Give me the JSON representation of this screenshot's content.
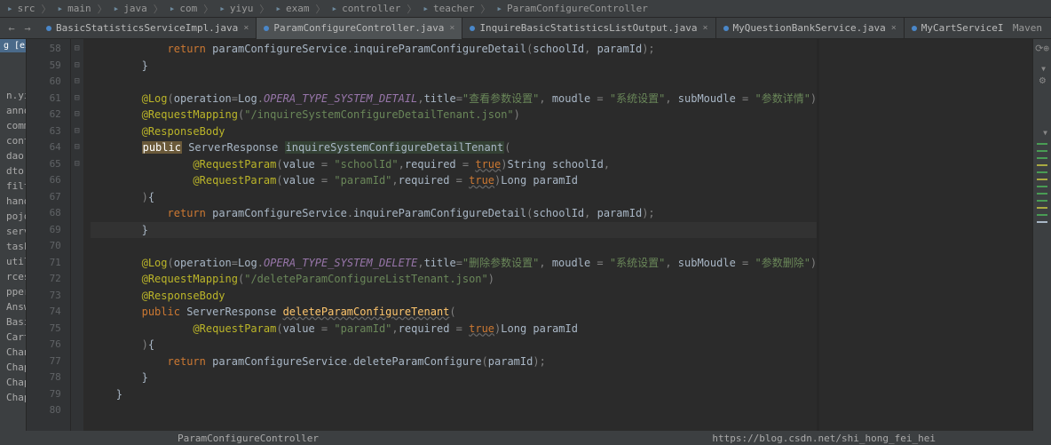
{
  "breadcrumb": [
    "src",
    "main",
    "java",
    "com",
    "yiyu",
    "exam",
    "controller",
    "teacher",
    "ParamConfigureController"
  ],
  "sidebar_header": "g [exam]  D:\\yiyu\\exam\\br...",
  "tabs": [
    {
      "label": "BasicStatisticsServiceImpl.java",
      "active": false
    },
    {
      "label": "ParamConfigureController.java",
      "active": true
    },
    {
      "label": "InquireBasicStatisticsListOutput.java",
      "active": false
    },
    {
      "label": "MyQuestionBankService.java",
      "active": false
    },
    {
      "label": "MyCartServiceImpl.java",
      "active": false
    }
  ],
  "maven_label": "Maven",
  "sidebar_items": [
    "n.yiyu.exam",
    "annotation",
    "common",
    "controller",
    "dao",
    "dto",
    "filter",
    "handle",
    "pojo",
    "service",
    "task",
    "util",
    "rces",
    "ppers",
    "AnswerQuestionMapper.xn",
    "BasicStatisticsMapper.xi",
    "CartMapper.xml",
    "ChannelTypeMapper.xml",
    "ChapterAnswerQuestionMa",
    "ChapterPaperChannelType",
    "ChapterPaperMapper.xml"
  ],
  "line_start": 58,
  "line_end": 80,
  "code_lines": {
    "58": {
      "indent": 3,
      "raw": "return paramConfigureService.inquireParamConfigureDetail(schoolId, paramId);",
      "tk": [
        [
          "k-orange",
          "return "
        ],
        [
          "k-white",
          "paramConfigureService"
        ],
        [
          "k-grey",
          "."
        ],
        [
          "k-white",
          "inquireParamConfigureDetail"
        ],
        [
          "k-grey",
          "("
        ],
        [
          "k-white",
          "schoolId"
        ],
        [
          "k-grey",
          ", "
        ],
        [
          "k-white",
          "paramId"
        ],
        [
          "k-grey",
          ")"
        ],
        [
          "k-grey",
          ";"
        ]
      ]
    },
    "59": {
      "indent": 2,
      "tk": [
        [
          "k-white",
          "}"
        ]
      ]
    },
    "60": {
      "indent": 0,
      "tk": []
    },
    "61": {
      "indent": 2,
      "tk": [
        [
          "k-anno",
          "@Log"
        ],
        [
          "k-grey",
          "("
        ],
        [
          "k-white",
          "operation"
        ],
        [
          "k-grey",
          "="
        ],
        [
          "k-white",
          "Log"
        ],
        [
          "k-grey",
          "."
        ],
        [
          "k-purple",
          "OPERA_TYPE_SYSTEM_DETAIL"
        ],
        [
          "k-grey",
          ","
        ],
        [
          "k-white",
          "title"
        ],
        [
          "k-grey",
          "="
        ],
        [
          "k-str",
          "\"查看参数设置\""
        ],
        [
          "k-grey",
          ", "
        ],
        [
          "k-white",
          "moudle "
        ],
        [
          "k-grey",
          "= "
        ],
        [
          "k-str",
          "\"系统设置\""
        ],
        [
          "k-grey",
          ", "
        ],
        [
          "k-white",
          "subMoudle "
        ],
        [
          "k-grey",
          "= "
        ],
        [
          "k-str",
          "\"参数详情\""
        ],
        [
          "k-grey",
          ")"
        ]
      ]
    },
    "62": {
      "indent": 2,
      "tk": [
        [
          "k-anno",
          "@RequestMapping"
        ],
        [
          "k-grey",
          "("
        ],
        [
          "k-str",
          "\"/inquireSystemConfigureDetailTenant.json\""
        ],
        [
          "k-grey",
          ")"
        ]
      ]
    },
    "63": {
      "indent": 2,
      "tk": [
        [
          "k-anno",
          "@ResponseBody"
        ]
      ]
    },
    "64": {
      "indent": 2,
      "tk": [
        [
          "hl-bg",
          "public"
        ],
        [
          "k-white",
          " ServerResponse "
        ],
        [
          "hl-method",
          "inquireSystemConfigureDetailTenant"
        ],
        [
          "k-grey",
          "("
        ]
      ]
    },
    "65": {
      "indent": 4,
      "tk": [
        [
          "k-anno",
          "@RequestParam"
        ],
        [
          "k-grey",
          "("
        ],
        [
          "k-white",
          "value "
        ],
        [
          "k-grey",
          "= "
        ],
        [
          "k-str",
          "\"schoolId\""
        ],
        [
          "k-grey",
          ","
        ],
        [
          "k-white",
          "required "
        ],
        [
          "k-grey",
          "= "
        ],
        [
          "k-orange underline",
          "true"
        ],
        [
          "k-grey",
          ")"
        ],
        [
          "k-white",
          "String schoolId"
        ],
        [
          "k-grey",
          ","
        ]
      ]
    },
    "66": {
      "indent": 4,
      "tk": [
        [
          "k-anno",
          "@RequestParam"
        ],
        [
          "k-grey",
          "("
        ],
        [
          "k-white",
          "value "
        ],
        [
          "k-grey",
          "= "
        ],
        [
          "k-str",
          "\"paramId\""
        ],
        [
          "k-grey",
          ","
        ],
        [
          "k-white",
          "required "
        ],
        [
          "k-grey",
          "= "
        ],
        [
          "k-orange underline",
          "true"
        ],
        [
          "k-grey",
          ")"
        ],
        [
          "k-white",
          "Long paramId"
        ]
      ]
    },
    "67": {
      "indent": 2,
      "tk": [
        [
          "k-grey",
          ")"
        ],
        [
          "k-white",
          "{"
        ]
      ]
    },
    "68": {
      "indent": 3,
      "tk": [
        [
          "k-orange",
          "return "
        ],
        [
          "k-white",
          "paramConfigureService"
        ],
        [
          "k-grey",
          "."
        ],
        [
          "k-white",
          "inquireParamConfigureDetail"
        ],
        [
          "k-grey",
          "("
        ],
        [
          "k-white",
          "schoolId"
        ],
        [
          "k-grey",
          ", "
        ],
        [
          "k-white",
          "paramId"
        ],
        [
          "k-grey",
          ")"
        ],
        [
          "k-grey",
          ";"
        ]
      ]
    },
    "69": {
      "indent": 2,
      "current": true,
      "tk": [
        [
          "k-white",
          "}"
        ]
      ]
    },
    "70": {
      "indent": 0,
      "tk": []
    },
    "71": {
      "indent": 2,
      "tk": [
        [
          "k-anno",
          "@Log"
        ],
        [
          "k-grey",
          "("
        ],
        [
          "k-white",
          "operation"
        ],
        [
          "k-grey",
          "="
        ],
        [
          "k-white",
          "Log"
        ],
        [
          "k-grey",
          "."
        ],
        [
          "k-purple",
          "OPERA_TYPE_SYSTEM_DELETE"
        ],
        [
          "k-grey",
          ","
        ],
        [
          "k-white",
          "title"
        ],
        [
          "k-grey",
          "="
        ],
        [
          "k-str",
          "\"删除参数设置\""
        ],
        [
          "k-grey",
          ", "
        ],
        [
          "k-white",
          "moudle "
        ],
        [
          "k-grey",
          "= "
        ],
        [
          "k-str",
          "\"系统设置\""
        ],
        [
          "k-grey",
          ", "
        ],
        [
          "k-white",
          "subMoudle "
        ],
        [
          "k-grey",
          "= "
        ],
        [
          "k-str",
          "\"参数删除\""
        ],
        [
          "k-grey",
          ")"
        ]
      ]
    },
    "72": {
      "indent": 2,
      "tk": [
        [
          "k-anno",
          "@RequestMapping"
        ],
        [
          "k-grey",
          "("
        ],
        [
          "k-str",
          "\"/deleteParamConfigureListTenant.json\""
        ],
        [
          "k-grey",
          ")"
        ]
      ]
    },
    "73": {
      "indent": 2,
      "tk": [
        [
          "k-anno",
          "@ResponseBody"
        ]
      ]
    },
    "74": {
      "indent": 2,
      "tk": [
        [
          "k-orange",
          "public "
        ],
        [
          "k-white",
          "ServerResponse "
        ],
        [
          "k-yellow underline",
          "deleteParamConfigureTenant"
        ],
        [
          "k-grey",
          "("
        ]
      ]
    },
    "75": {
      "indent": 4,
      "tk": [
        [
          "k-anno",
          "@RequestParam"
        ],
        [
          "k-grey",
          "("
        ],
        [
          "k-white",
          "value "
        ],
        [
          "k-grey",
          "= "
        ],
        [
          "k-str",
          "\"paramId\""
        ],
        [
          "k-grey",
          ","
        ],
        [
          "k-white",
          "required "
        ],
        [
          "k-grey",
          "= "
        ],
        [
          "k-orange underline",
          "true"
        ],
        [
          "k-grey",
          ")"
        ],
        [
          "k-white",
          "Long paramId"
        ]
      ]
    },
    "76": {
      "indent": 2,
      "tk": [
        [
          "k-grey",
          ")"
        ],
        [
          "k-white",
          "{"
        ]
      ]
    },
    "77": {
      "indent": 3,
      "tk": [
        [
          "k-orange",
          "return "
        ],
        [
          "k-white",
          "paramConfigureService"
        ],
        [
          "k-grey",
          "."
        ],
        [
          "k-white",
          "deleteParamConfigure"
        ],
        [
          "k-grey",
          "("
        ],
        [
          "k-white",
          "paramId"
        ],
        [
          "k-grey",
          ")"
        ],
        [
          "k-grey",
          ";"
        ]
      ]
    },
    "78": {
      "indent": 2,
      "tk": [
        [
          "k-white",
          "}"
        ]
      ]
    },
    "79": {
      "indent": 1,
      "tk": [
        [
          "k-white",
          "}"
        ]
      ]
    },
    "80": {
      "indent": 0,
      "tk": []
    }
  },
  "folds": {
    "59": "⊟",
    "61": "⊟",
    "67": "⊟",
    "69": "⊟",
    "71": "⊟",
    "76": "⊟",
    "78": "⊟",
    "79": "⊟"
  },
  "status_left": "ParamConfigureController",
  "status_right": "https://blog.csdn.net/shi_hong_fei_hei"
}
